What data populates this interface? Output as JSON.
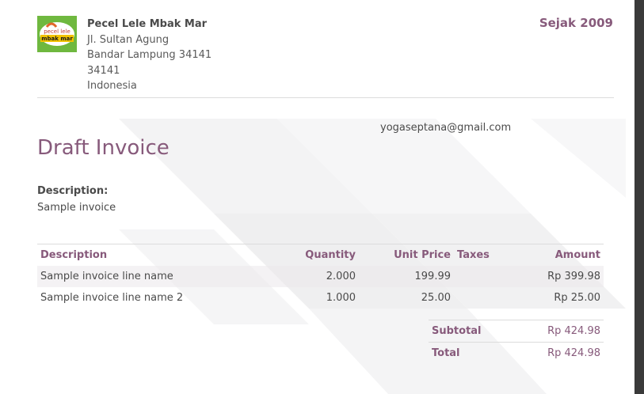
{
  "company": {
    "name": "Pecel Lele Mbak Mar",
    "address_lines": [
      "Jl. Sultan Agung",
      "Bandar Lampung 34141",
      "34141",
      "Indonesia"
    ],
    "logo_text": [
      "pecel lele",
      "mbak mar"
    ],
    "logo_color": "#6fb83f"
  },
  "tagline": "Sejak 2009",
  "customer_email": "yogaseptana@gmail.com",
  "invoice": {
    "title": "Draft Invoice",
    "description_label": "Description:",
    "description_value": "Sample invoice"
  },
  "table": {
    "headers": [
      "Description",
      "Quantity",
      "Unit Price",
      "Taxes",
      "Amount"
    ],
    "rows": [
      {
        "description": "Sample invoice line name",
        "quantity": "2.000",
        "unit_price": "199.99",
        "taxes": "",
        "amount": "Rp 399.98"
      },
      {
        "description": "Sample invoice line name 2",
        "quantity": "1.000",
        "unit_price": "25.00",
        "taxes": "",
        "amount": "Rp 25.00"
      }
    ]
  },
  "totals": {
    "subtotal_label": "Subtotal",
    "subtotal_value": "Rp 424.98",
    "total_label": "Total",
    "total_value": "Rp 424.98"
  },
  "colors": {
    "accent": "#875a7b",
    "text": "#4a4a4a",
    "divider": "#dcdcdc"
  }
}
